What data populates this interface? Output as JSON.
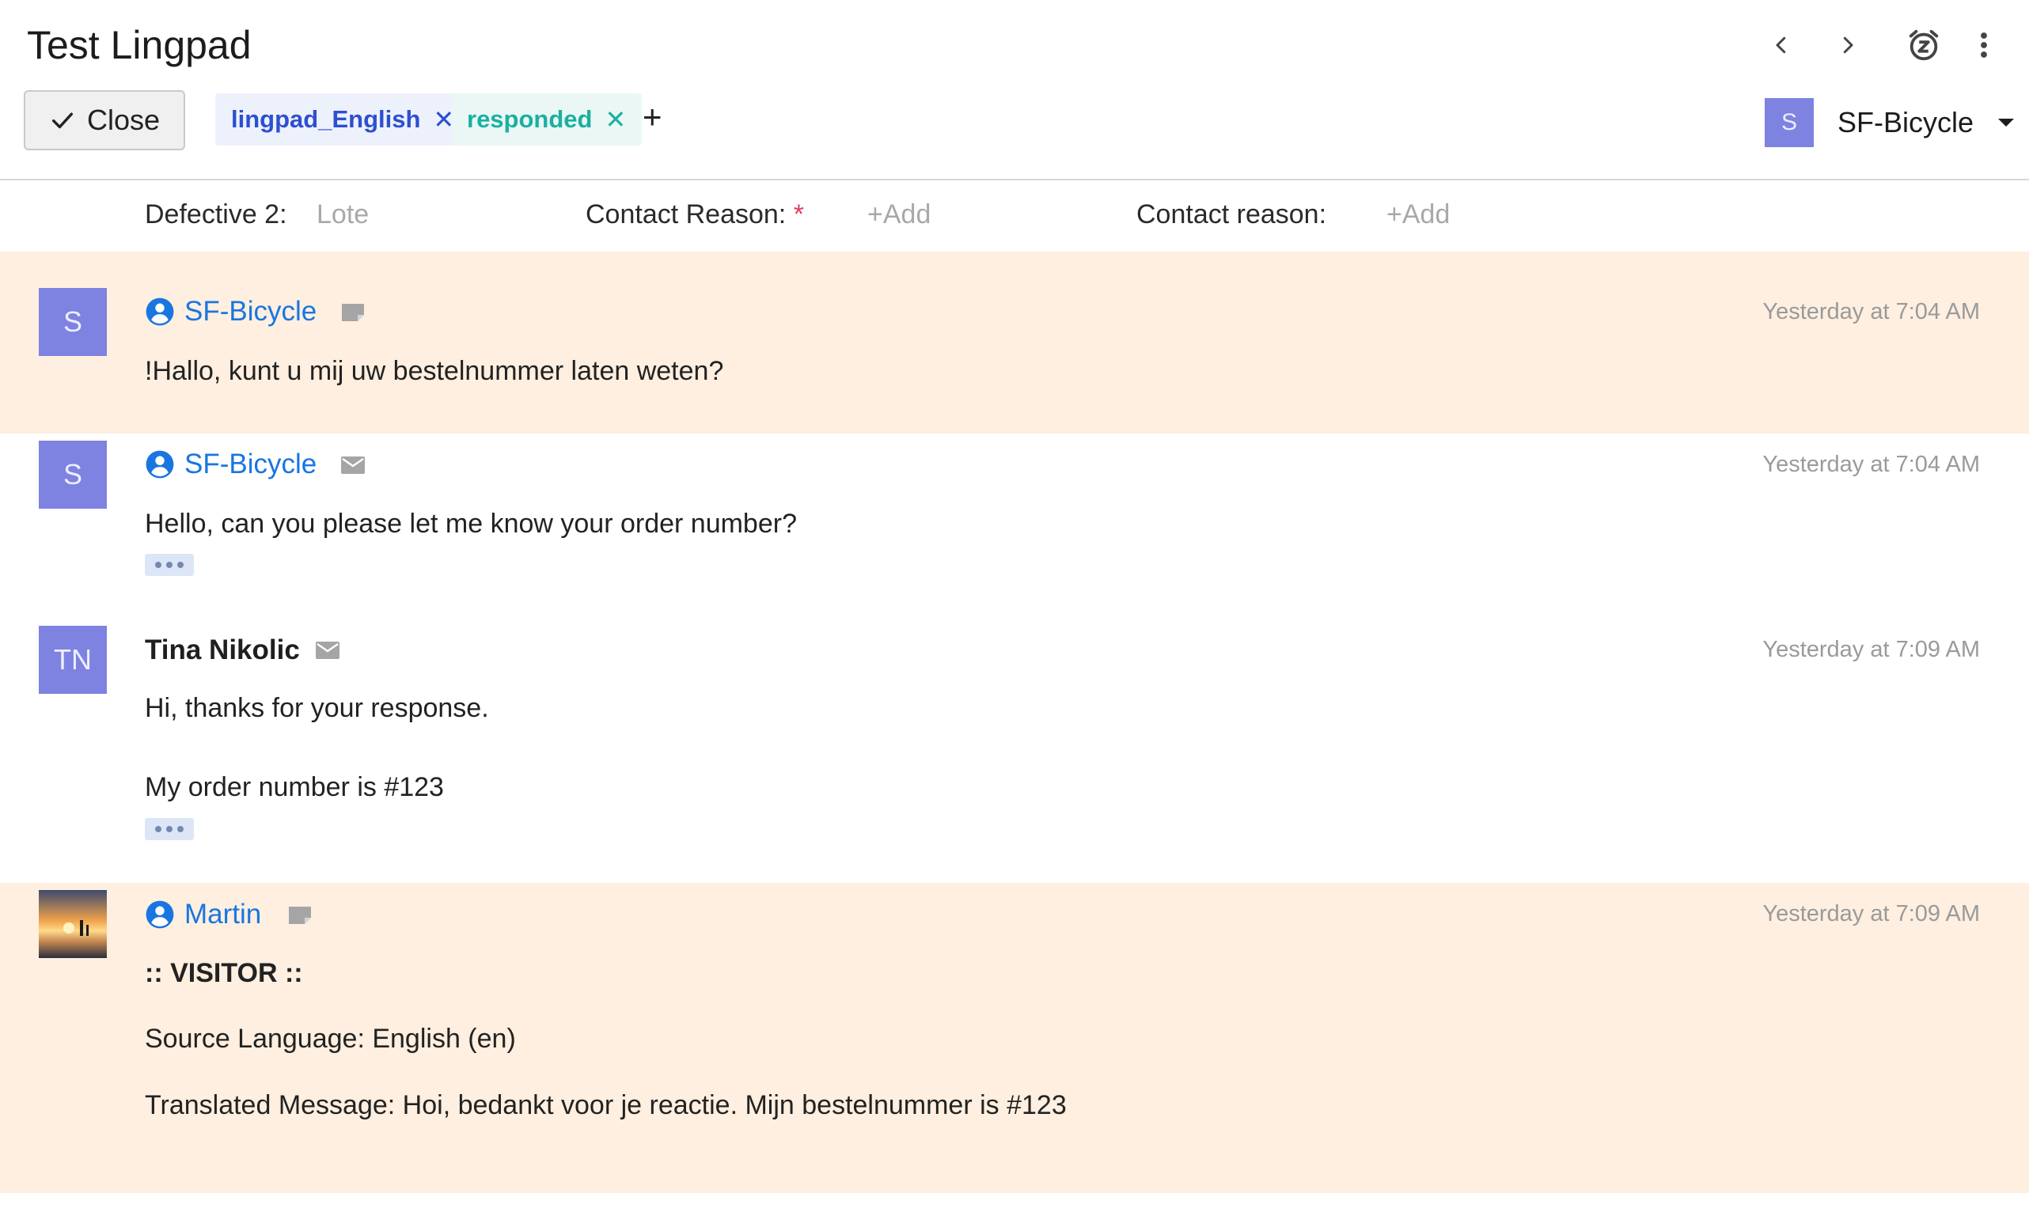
{
  "header": {
    "title": "Test Lingpad",
    "close_label": "Close",
    "tags": [
      {
        "label": "lingpad_English",
        "color": "#2d4fd0"
      },
      {
        "label": "responded",
        "color": "#1ab0a1"
      }
    ],
    "add_tag": "+",
    "team": {
      "initial": "S",
      "name": "SF-Bicycle"
    }
  },
  "fields": {
    "defective_label": "Defective 2:",
    "defective_placeholder": "Lote",
    "contact_reason_label": "Contact Reason:",
    "required_mark": "*",
    "contact_reason_add": "+Add",
    "contact_reason2_label": "Contact reason:",
    "contact_reason2_add": "+Add"
  },
  "messages": [
    {
      "avatar": "S",
      "sender": "SF-Bicycle",
      "channel_icon": "note-icon",
      "time": "Yesterday at 7:04 AM",
      "body": "!Hallo, kunt u mij uw bestelnummer laten weten?"
    },
    {
      "avatar": "S",
      "sender": "SF-Bicycle",
      "channel_icon": "mail-icon",
      "time": "Yesterday at 7:04 AM",
      "body": "Hello, can you please let me know your order number?"
    },
    {
      "avatar": "TN",
      "sender": "Tina Nikolic",
      "channel_icon": "mail-icon",
      "time": "Yesterday at 7:09 AM",
      "body_line1": "Hi, thanks for your response.",
      "body_line2": "My order number is #123"
    },
    {
      "avatar_image": "sunset-photo",
      "sender": "Martin",
      "channel_icon": "note-icon",
      "time": "Yesterday at 7:09 AM",
      "heading": ":: VISITOR ::",
      "source_line": "Source Language: English (en)",
      "translated_line": "Translated Message: Hoi, bedankt voor je reactie. Mijn bestelnummer is #123"
    }
  ],
  "colors": {
    "note_bg": "#feefe0",
    "link": "#1976e0",
    "avatar": "#7e82e0"
  }
}
